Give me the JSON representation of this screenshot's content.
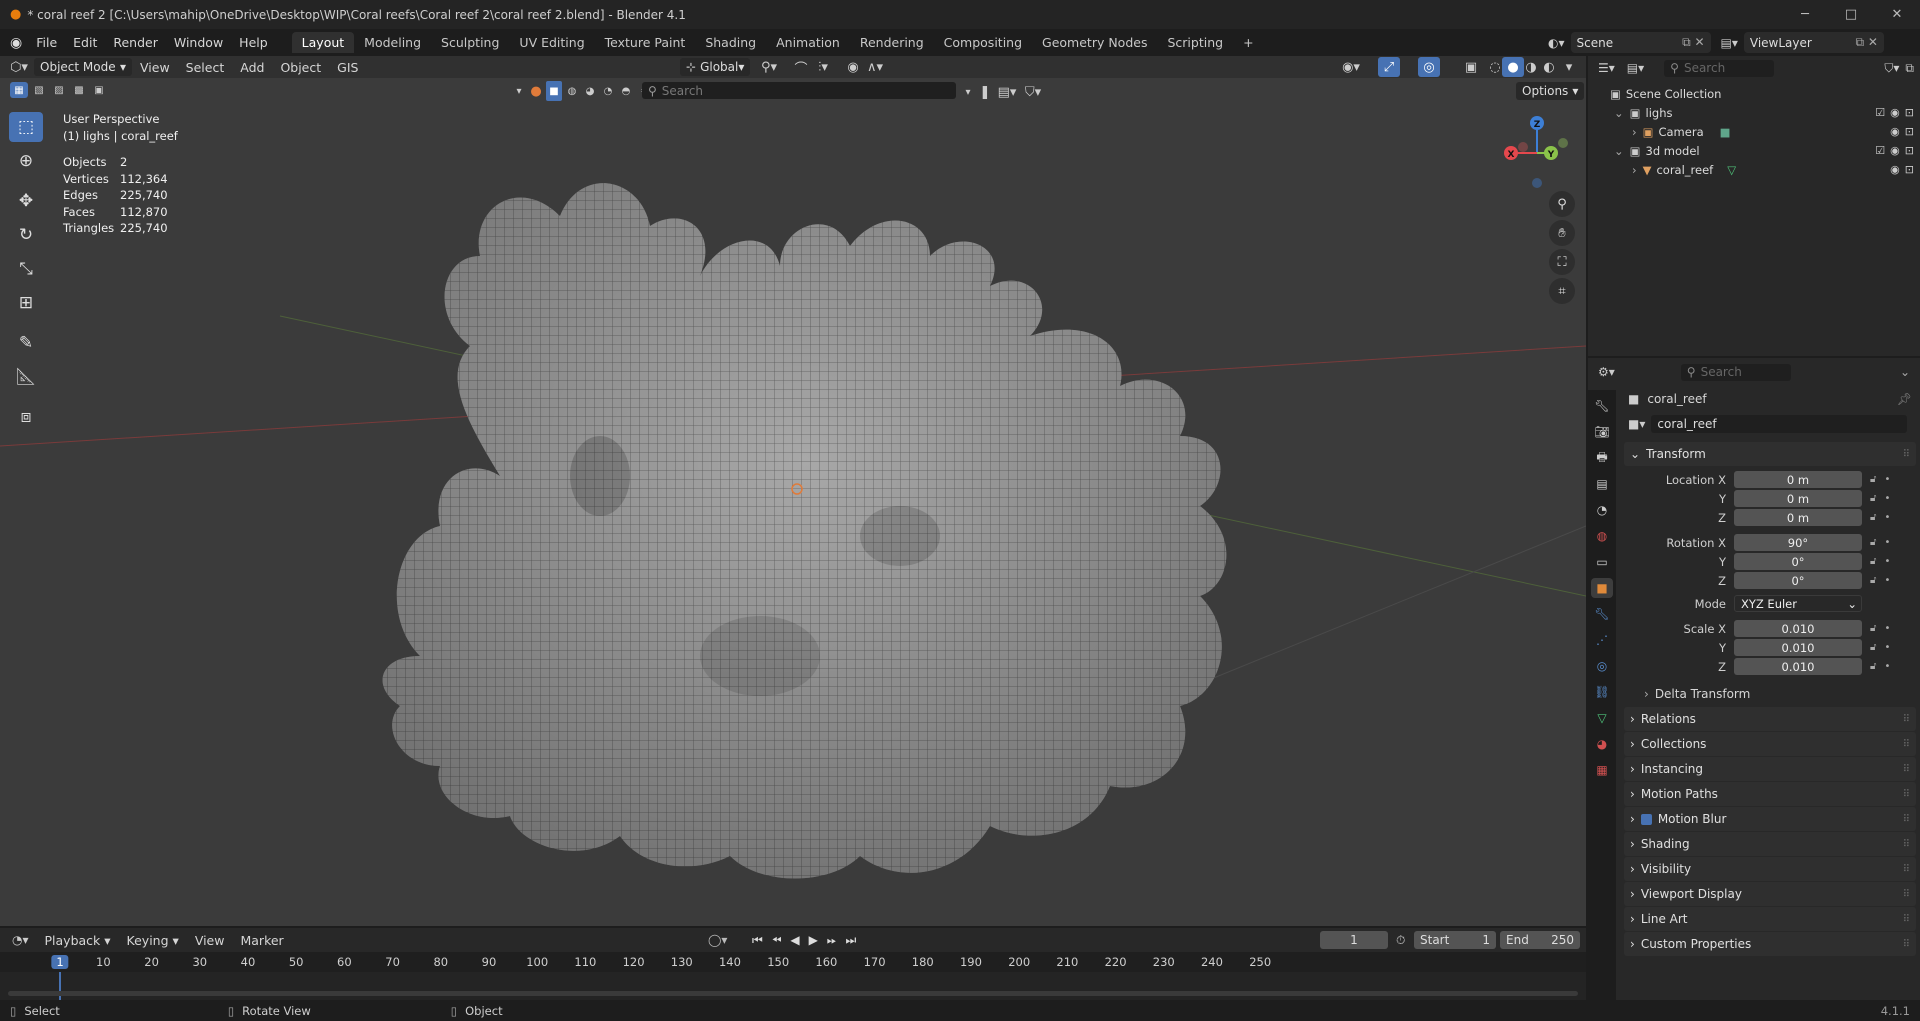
{
  "window": {
    "title": "* coral reef 2 [C:\\Users\\mahip\\OneDrive\\Desktop\\WIP\\Coral reefs\\Coral reef 2\\coral reef 2.blend] - Blender 4.1"
  },
  "menus": [
    "File",
    "Edit",
    "Render",
    "Window",
    "Help"
  ],
  "workspaces": [
    "Layout",
    "Modeling",
    "Sculpting",
    "UV Editing",
    "Texture Paint",
    "Shading",
    "Animation",
    "Rendering",
    "Compositing",
    "Geometry Nodes",
    "Scripting"
  ],
  "active_workspace": "Layout",
  "scene": {
    "name": "Scene",
    "view_layer": "ViewLayer"
  },
  "viewport": {
    "mode": "Object Mode",
    "menus": [
      "View",
      "Select",
      "Add",
      "Object",
      "GIS"
    ],
    "transform_orientation": "Global",
    "search_placeholder": "Search",
    "options_label": "Options",
    "perspective": "User Perspective",
    "context": "(1) lighs | coral_reef",
    "stats": [
      {
        "label": "Objects",
        "value": "2"
      },
      {
        "label": "Vertices",
        "value": "112,364"
      },
      {
        "label": "Edges",
        "value": "225,740"
      },
      {
        "label": "Faces",
        "value": "112,870"
      },
      {
        "label": "Triangles",
        "value": "225,740"
      }
    ],
    "gizmo": {
      "x": "X",
      "y": "Y",
      "z": "Z"
    }
  },
  "outliner": {
    "search_placeholder": "Search",
    "root": "Scene Collection",
    "items": [
      {
        "label": "lighs",
        "level": 1,
        "type": "collection"
      },
      {
        "label": "Camera",
        "level": 2,
        "type": "camera"
      },
      {
        "label": "3d model",
        "level": 1,
        "type": "collection"
      },
      {
        "label": "coral_reef",
        "level": 2,
        "type": "mesh"
      }
    ]
  },
  "properties": {
    "search_placeholder": "Search",
    "object_name": "coral_reef",
    "object_field": "coral_reef",
    "transform_label": "Transform",
    "location": {
      "label_x": "Location X",
      "x": "0 m",
      "y": "0 m",
      "z": "0 m"
    },
    "rotation": {
      "label_x": "Rotation X",
      "x": "90°",
      "y": "0°",
      "z": "0°"
    },
    "mode": {
      "label": "Mode",
      "value": "XYZ Euler"
    },
    "scale": {
      "label_x": "Scale X",
      "x": "0.010",
      "y": "0.010",
      "z": "0.010"
    },
    "axis_y": "Y",
    "axis_z": "Z",
    "delta_transform": "Delta Transform",
    "panels": [
      "Relations",
      "Collections",
      "Instancing",
      "Motion Paths",
      "Motion Blur",
      "Shading",
      "Visibility",
      "Viewport Display",
      "Line Art",
      "Custom Properties"
    ]
  },
  "timeline": {
    "menus": [
      "Playback",
      "Keying",
      "View",
      "Marker"
    ],
    "current_frame": "1",
    "start_label": "Start",
    "start": "1",
    "end_label": "End",
    "end": "250",
    "ticks": [
      "1",
      "10",
      "20",
      "30",
      "40",
      "50",
      "60",
      "70",
      "80",
      "90",
      "100",
      "110",
      "120",
      "130",
      "140",
      "150",
      "160",
      "170",
      "180",
      "190",
      "200",
      "210",
      "220",
      "230",
      "240",
      "250"
    ]
  },
  "statusbar": {
    "select": "Select",
    "rotate": "Rotate View",
    "object": "Object",
    "version": "4.1.1"
  },
  "colors": {
    "accent": "#4772b3",
    "x_axis": "#e5484d",
    "y_axis": "#8bc34a",
    "z_axis": "#3d7fd6",
    "mesh": "#a9a9a9"
  }
}
